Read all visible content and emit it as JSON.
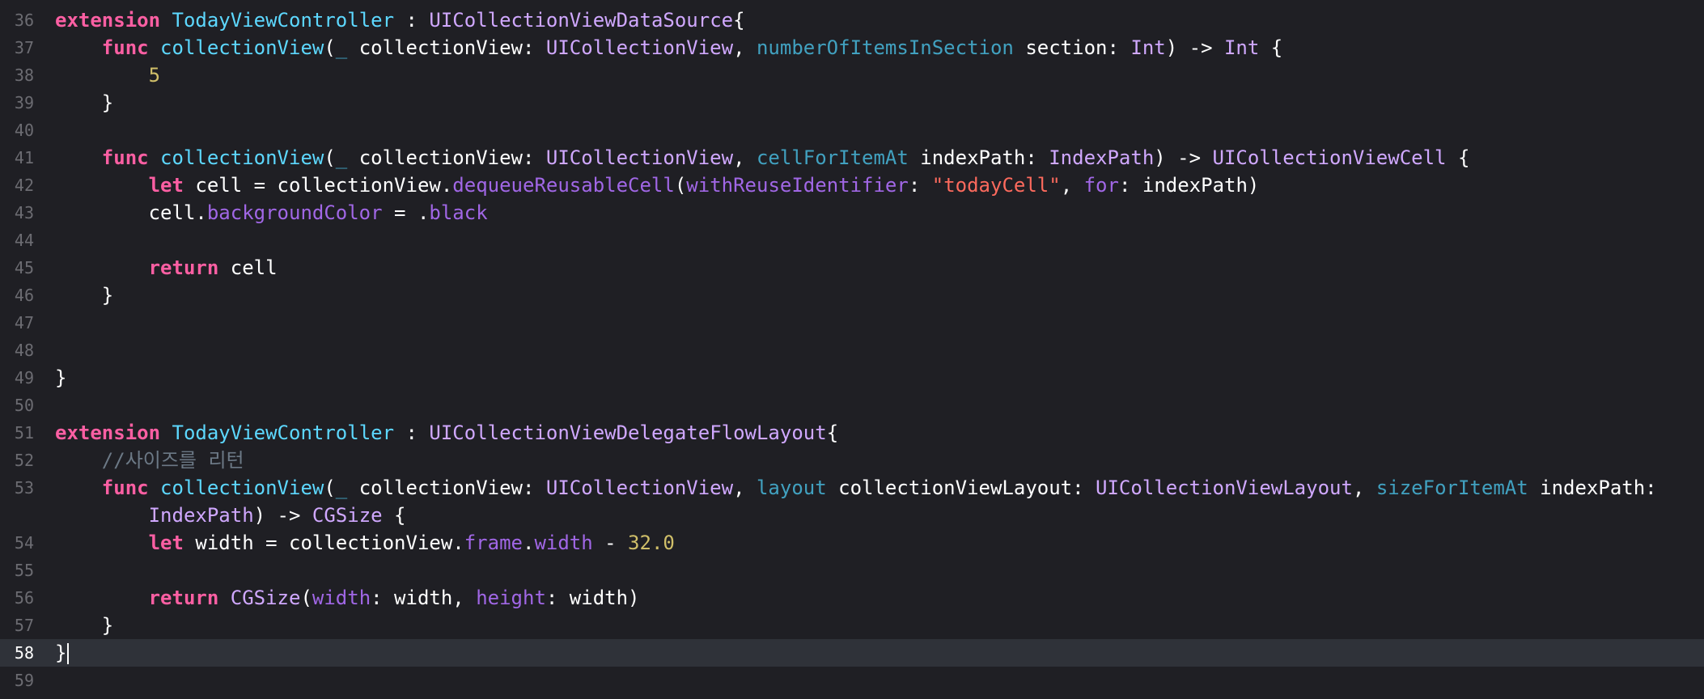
{
  "editor": {
    "background": "#1f1f24",
    "current_line_background": "#2f3239",
    "current_line_number": "58"
  },
  "theme": {
    "keyword": "#fc5fa3",
    "type": "#d0a8ff",
    "declaration": "#5dd8ff",
    "parameter_label": "#41a1c0",
    "property": "#a167e6",
    "number": "#d0bf69",
    "string": "#fc6a5d",
    "comment": "#6c7986",
    "plain": "#ffffff"
  },
  "lines": [
    {
      "num": "36",
      "indent": 0,
      "tokens": [
        [
          "kw",
          "extension"
        ],
        [
          "p",
          " "
        ],
        [
          "decl",
          "TodayViewController"
        ],
        [
          "p",
          " : "
        ],
        [
          "type",
          "UICollectionViewDataSource"
        ],
        [
          "p",
          "{"
        ]
      ]
    },
    {
      "num": "37",
      "indent": 1,
      "tokens": [
        [
          "kw",
          "func"
        ],
        [
          "p",
          " "
        ],
        [
          "decl",
          "collectionView"
        ],
        [
          "p",
          "("
        ],
        [
          "param",
          "_"
        ],
        [
          "p",
          " collectionView: "
        ],
        [
          "type",
          "UICollectionView"
        ],
        [
          "p",
          ", "
        ],
        [
          "param",
          "numberOfItemsInSection"
        ],
        [
          "p",
          " section: "
        ],
        [
          "type",
          "Int"
        ],
        [
          "p",
          ") -> "
        ],
        [
          "type",
          "Int"
        ],
        [
          "p",
          " {"
        ]
      ]
    },
    {
      "num": "38",
      "indent": 2,
      "tokens": [
        [
          "num",
          "5"
        ]
      ]
    },
    {
      "num": "39",
      "indent": 1,
      "tokens": [
        [
          "p",
          "}"
        ]
      ]
    },
    {
      "num": "40",
      "indent": 0,
      "tokens": []
    },
    {
      "num": "41",
      "indent": 1,
      "tokens": [
        [
          "kw",
          "func"
        ],
        [
          "p",
          " "
        ],
        [
          "decl",
          "collectionView"
        ],
        [
          "p",
          "("
        ],
        [
          "param",
          "_"
        ],
        [
          "p",
          " collectionView: "
        ],
        [
          "type",
          "UICollectionView"
        ],
        [
          "p",
          ", "
        ],
        [
          "param",
          "cellForItemAt"
        ],
        [
          "p",
          " indexPath: "
        ],
        [
          "type",
          "IndexPath"
        ],
        [
          "p",
          ") -> "
        ],
        [
          "type",
          "UICollectionViewCell"
        ],
        [
          "p",
          " {"
        ]
      ]
    },
    {
      "num": "42",
      "indent": 2,
      "tokens": [
        [
          "kw",
          "let"
        ],
        [
          "p",
          " cell = collectionView."
        ],
        [
          "prop",
          "dequeueReusableCell"
        ],
        [
          "p",
          "("
        ],
        [
          "prop",
          "withReuseIdentifier"
        ],
        [
          "p",
          ": "
        ],
        [
          "str",
          "\"todayCell\""
        ],
        [
          "p",
          ", "
        ],
        [
          "prop",
          "for"
        ],
        [
          "p",
          ": indexPath)"
        ]
      ]
    },
    {
      "num": "43",
      "indent": 2,
      "tokens": [
        [
          "p",
          "cell."
        ],
        [
          "prop",
          "backgroundColor"
        ],
        [
          "p",
          " = ."
        ],
        [
          "prop",
          "black"
        ]
      ]
    },
    {
      "num": "44",
      "indent": 0,
      "tokens": []
    },
    {
      "num": "45",
      "indent": 2,
      "tokens": [
        [
          "kw",
          "return"
        ],
        [
          "p",
          " cell"
        ]
      ]
    },
    {
      "num": "46",
      "indent": 1,
      "tokens": [
        [
          "p",
          "}"
        ]
      ]
    },
    {
      "num": "47",
      "indent": 0,
      "tokens": []
    },
    {
      "num": "48",
      "indent": 0,
      "tokens": []
    },
    {
      "num": "49",
      "indent": 0,
      "tokens": [
        [
          "p",
          "}"
        ]
      ]
    },
    {
      "num": "50",
      "indent": 0,
      "tokens": []
    },
    {
      "num": "51",
      "indent": 0,
      "tokens": [
        [
          "kw",
          "extension"
        ],
        [
          "p",
          " "
        ],
        [
          "decl",
          "TodayViewController"
        ],
        [
          "p",
          " : "
        ],
        [
          "type",
          "UICollectionViewDelegateFlowLayout"
        ],
        [
          "p",
          "{"
        ]
      ]
    },
    {
      "num": "52",
      "indent": 1,
      "tokens": [
        [
          "cmt",
          "//사이즈를 리턴"
        ]
      ]
    },
    {
      "num": "53",
      "indent": 1,
      "tokens": [
        [
          "kw",
          "func"
        ],
        [
          "p",
          " "
        ],
        [
          "decl",
          "collectionView"
        ],
        [
          "p",
          "("
        ],
        [
          "param",
          "_"
        ],
        [
          "p",
          " collectionView: "
        ],
        [
          "type",
          "UICollectionView"
        ],
        [
          "p",
          ", "
        ],
        [
          "param",
          "layout"
        ],
        [
          "p",
          " collectionViewLayout: "
        ],
        [
          "type",
          "UICollectionViewLayout"
        ],
        [
          "p",
          ", "
        ],
        [
          "param",
          "sizeForItemAt"
        ],
        [
          "p",
          " indexPath:"
        ]
      ]
    },
    {
      "num": "",
      "indent": 2,
      "tokens": [
        [
          "type",
          "IndexPath"
        ],
        [
          "p",
          ") -> "
        ],
        [
          "type",
          "CGSize"
        ],
        [
          "p",
          " {"
        ]
      ]
    },
    {
      "num": "54",
      "indent": 2,
      "tokens": [
        [
          "kw",
          "let"
        ],
        [
          "p",
          " width = collectionView."
        ],
        [
          "prop",
          "frame"
        ],
        [
          "p",
          "."
        ],
        [
          "prop",
          "width"
        ],
        [
          "p",
          " - "
        ],
        [
          "num",
          "32.0"
        ]
      ]
    },
    {
      "num": "55",
      "indent": 0,
      "tokens": []
    },
    {
      "num": "56",
      "indent": 2,
      "tokens": [
        [
          "kw",
          "return"
        ],
        [
          "p",
          " "
        ],
        [
          "type",
          "CGSize"
        ],
        [
          "p",
          "("
        ],
        [
          "prop",
          "width"
        ],
        [
          "p",
          ": width, "
        ],
        [
          "prop",
          "height"
        ],
        [
          "p",
          ": width)"
        ]
      ]
    },
    {
      "num": "57",
      "indent": 1,
      "tokens": [
        [
          "p",
          "}"
        ]
      ]
    },
    {
      "num": "58",
      "indent": 0,
      "current": true,
      "tokens": [
        [
          "p",
          "}"
        ]
      ]
    },
    {
      "num": "59",
      "indent": 0,
      "tokens": []
    }
  ]
}
